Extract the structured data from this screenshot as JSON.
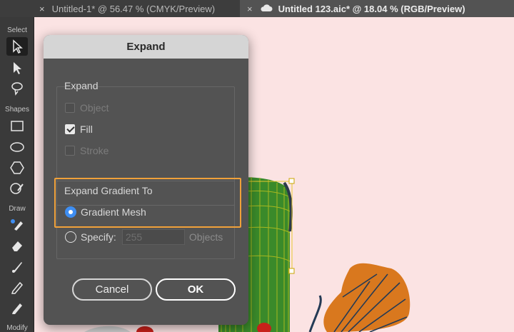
{
  "tabs": [
    {
      "close": "×",
      "label": "Untitled-1* @ 56.47 % (CMYK/Preview)",
      "active": false
    },
    {
      "close": "×",
      "icon": "cloud-icon",
      "label": "Untitled 123.aic* @ 18.04 % (RGB/Preview)",
      "active": true
    }
  ],
  "toolbar": {
    "select_label": "Select",
    "shapes_label": "Shapes",
    "draw_label": "Draw",
    "modify_label": "Modify",
    "tools": [
      "selection-tool-icon",
      "direct-selection-tool-icon",
      "lasso-tool-icon",
      "rectangle-tool-icon",
      "ellipse-tool-icon",
      "polygon-tool-icon",
      "shaper-tool-icon",
      "pen-tool-icon",
      "eraser-tool-icon",
      "brush-tool-icon",
      "pencil-tool-icon",
      "paintbrush-tool-icon"
    ]
  },
  "dialog": {
    "title": "Expand",
    "expand_group": {
      "label": "Expand",
      "object_label": "Object",
      "object_checked": false,
      "fill_label": "Fill",
      "fill_checked": true,
      "stroke_label": "Stroke",
      "stroke_checked": false
    },
    "gradient_group": {
      "label": "Expand Gradient To",
      "gradient_mesh_label": "Gradient Mesh",
      "gradient_mesh_selected": true,
      "specify_label": "Specify:",
      "specify_value": "255",
      "specify_units": "Objects"
    },
    "cancel_label": "Cancel",
    "ok_label": "OK"
  },
  "colors": {
    "canvas": "#fbe3e3",
    "highlight": "#f0a13a",
    "radio_accent": "#3e8ef2",
    "mesh_green": "#3a8a2a",
    "leaf_orange": "#d9781e",
    "stroke_navy": "#243a55"
  }
}
